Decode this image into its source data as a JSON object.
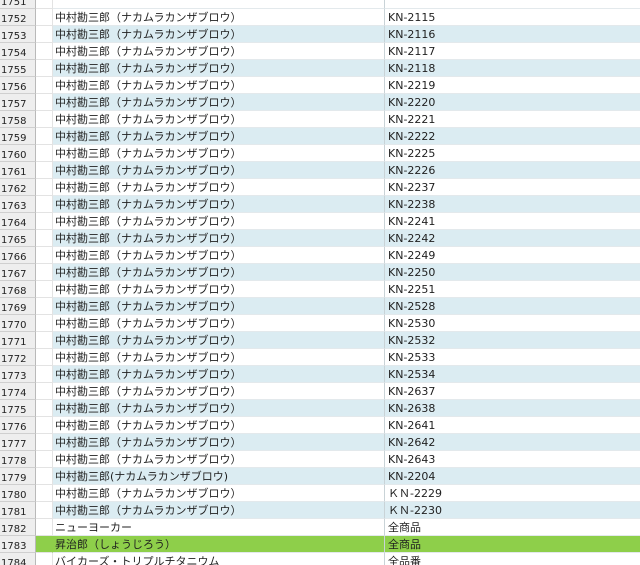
{
  "rows": [
    {
      "num": "1751",
      "name": "",
      "code": "",
      "style": "odd"
    },
    {
      "num": "1752",
      "name": "中村勘三郎（ナカムラカンザブロウ）",
      "code": "KN-2115",
      "style": "odd"
    },
    {
      "num": "1753",
      "name": "中村勘三郎（ナカムラカンザブロウ）",
      "code": "KN-2116",
      "style": "even"
    },
    {
      "num": "1754",
      "name": "中村勘三郎（ナカムラカンザブロウ）",
      "code": "KN-2117",
      "style": "odd"
    },
    {
      "num": "1755",
      "name": "中村勘三郎（ナカムラカンザブロウ）",
      "code": "KN-2118",
      "style": "even"
    },
    {
      "num": "1756",
      "name": "中村勘三郎（ナカムラカンザブロウ）",
      "code": "KN-2219",
      "style": "odd"
    },
    {
      "num": "1757",
      "name": "中村勘三郎（ナカムラカンザブロウ）",
      "code": "KN-2220",
      "style": "even"
    },
    {
      "num": "1758",
      "name": "中村勘三郎（ナカムラカンザブロウ）",
      "code": "KN-2221",
      "style": "odd"
    },
    {
      "num": "1759",
      "name": "中村勘三郎（ナカムラカンザブロウ）",
      "code": "KN-2222",
      "style": "even"
    },
    {
      "num": "1760",
      "name": "中村勘三郎（ナカムラカンザブロウ）",
      "code": "KN-2225",
      "style": "odd"
    },
    {
      "num": "1761",
      "name": "中村勘三郎（ナカムラカンザブロウ）",
      "code": "KN-2226",
      "style": "even"
    },
    {
      "num": "1762",
      "name": "中村勘三郎（ナカムラカンザブロウ）",
      "code": "KN-2237",
      "style": "odd"
    },
    {
      "num": "1763",
      "name": "中村勘三郎（ナカムラカンザブロウ）",
      "code": "KN-2238",
      "style": "even"
    },
    {
      "num": "1764",
      "name": "中村勘三郎（ナカムラカンザブロウ）",
      "code": "KN-2241",
      "style": "odd"
    },
    {
      "num": "1765",
      "name": "中村勘三郎（ナカムラカンザブロウ）",
      "code": "KN-2242",
      "style": "even"
    },
    {
      "num": "1766",
      "name": "中村勘三郎（ナカムラカンザブロウ）",
      "code": "KN-2249",
      "style": "odd"
    },
    {
      "num": "1767",
      "name": "中村勘三郎（ナカムラカンザブロウ）",
      "code": "KN-2250",
      "style": "even"
    },
    {
      "num": "1768",
      "name": "中村勘三郎（ナカムラカンザブロウ）",
      "code": "KN-2251",
      "style": "odd"
    },
    {
      "num": "1769",
      "name": "中村勘三郎（ナカムラカンザブロウ）",
      "code": "KN-2528",
      "style": "even"
    },
    {
      "num": "1770",
      "name": "中村勘三郎（ナカムラカンザブロウ）",
      "code": "KN-2530",
      "style": "odd"
    },
    {
      "num": "1771",
      "name": "中村勘三郎（ナカムラカンザブロウ）",
      "code": "KN-2532",
      "style": "even"
    },
    {
      "num": "1772",
      "name": "中村勘三郎（ナカムラカンザブロウ）",
      "code": "KN-2533",
      "style": "odd"
    },
    {
      "num": "1773",
      "name": "中村勘三郎（ナカムラカンザブロウ）",
      "code": "KN-2534",
      "style": "even"
    },
    {
      "num": "1774",
      "name": "中村勘三郎（ナカムラカンザブロウ）",
      "code": "KN-2637",
      "style": "odd"
    },
    {
      "num": "1775",
      "name": "中村勘三郎（ナカムラカンザブロウ）",
      "code": "KN-2638",
      "style": "even"
    },
    {
      "num": "1776",
      "name": "中村勘三郎（ナカムラカンザブロウ）",
      "code": "KN-2641",
      "style": "odd"
    },
    {
      "num": "1777",
      "name": "中村勘三郎（ナカムラカンザブロウ）",
      "code": "KN-2642",
      "style": "even"
    },
    {
      "num": "1778",
      "name": "中村勘三郎（ナカムラカンザブロウ）",
      "code": "KN-2643",
      "style": "odd"
    },
    {
      "num": "1779",
      "name": "中村勘三郎(ナカムラカンザブロウ)",
      "code": "KN-2204",
      "style": "even"
    },
    {
      "num": "1780",
      "name": "中村勘三郎（ナカムラカンザブロウ）",
      "code": "ＫＮ-2229",
      "style": "odd"
    },
    {
      "num": "1781",
      "name": "中村勘三郎（ナカムラカンザブロウ）",
      "code": "ＫＮ-2230",
      "style": "even"
    },
    {
      "num": "1782",
      "name": "ニューヨーカー",
      "code": "全商品",
      "style": "odd"
    },
    {
      "num": "1783",
      "name": "昇治郎（しょうじろう）",
      "code": "全商品",
      "style": "highlight"
    },
    {
      "num": "1784",
      "name": "バイカーズ・トリプルチタニウム",
      "code": "全品番",
      "style": "odd"
    }
  ]
}
